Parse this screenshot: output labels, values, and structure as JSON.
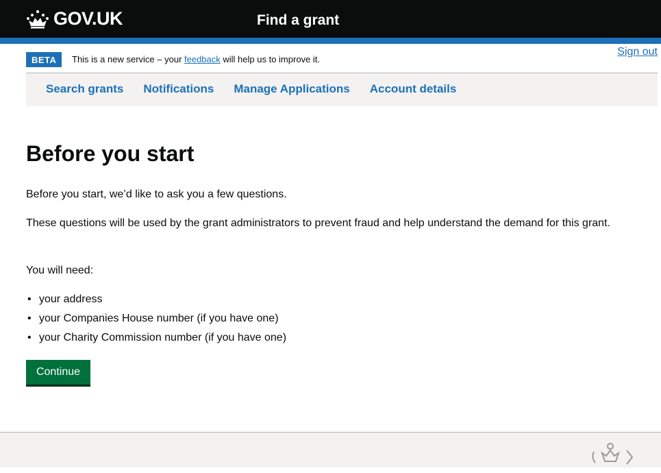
{
  "header": {
    "logo_text": "GOV.UK",
    "service_name": "Find a grant",
    "brand_color": "#0b0c0c",
    "accent_color": "#1d70b8"
  },
  "phase_banner": {
    "tag": "BETA",
    "text_before": "This is a new service – your ",
    "link_text": "feedback",
    "text_after": " will help us to improve it.",
    "sign_out": "Sign out"
  },
  "nav": {
    "items": [
      {
        "label": "Search grants"
      },
      {
        "label": "Notifications"
      },
      {
        "label": "Manage Applications"
      },
      {
        "label": "Account details"
      }
    ]
  },
  "main": {
    "title": "Before you start",
    "intro": "Before you start, we’d like to ask you a few questions.",
    "explanation": "These questions will be used by the grant administrators to prevent fraud and help understand the demand for this grant.",
    "needs_heading": "You will need:",
    "needs": [
      "your address",
      "your Companies House number (if you have one)",
      "your Charity Commission number (if you have one)"
    ],
    "continue_label": "Continue",
    "button_color": "#00703c"
  },
  "icons": {
    "logo": "crown-icon",
    "footer": "royal-crest-icon"
  }
}
